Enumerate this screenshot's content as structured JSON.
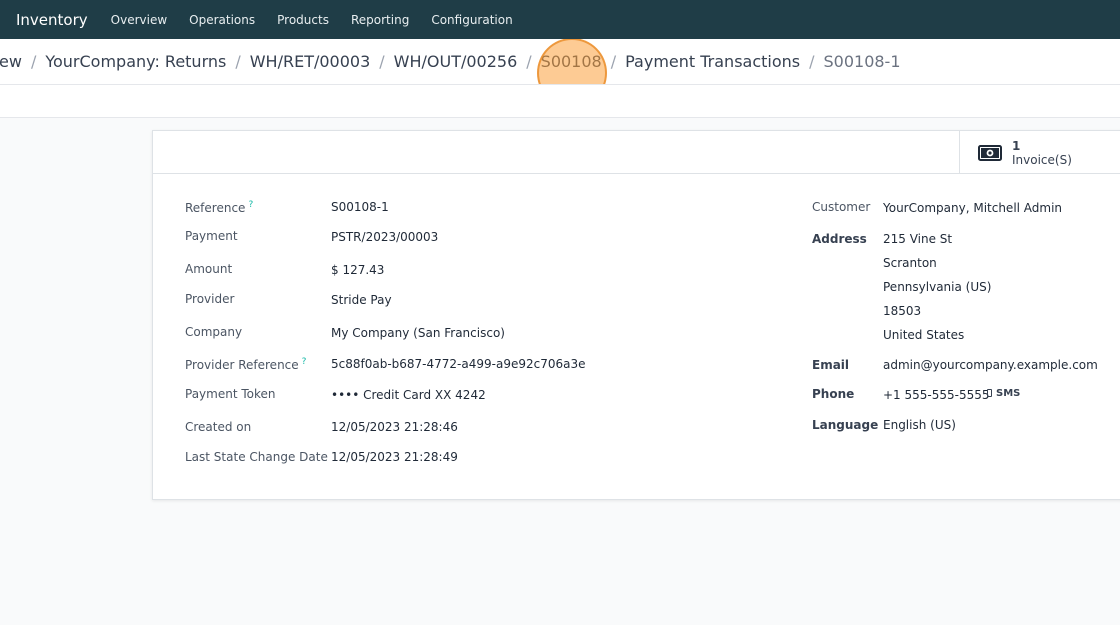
{
  "navbar": {
    "app_name": "Inventory",
    "menu": [
      "Overview",
      "Operations",
      "Products",
      "Reporting",
      "Configuration"
    ]
  },
  "breadcrumb": {
    "items": [
      "ew",
      "YourCompany: Returns",
      "WH/RET/00003",
      "WH/OUT/00256",
      "S00108",
      "Payment Transactions"
    ],
    "separator": "/",
    "current": "S00108-1"
  },
  "stat_button": {
    "value": "1",
    "label": "Invoice(S)"
  },
  "left_fields": {
    "reference": {
      "label": "Reference",
      "help": "?",
      "value": "S00108-1"
    },
    "payment": {
      "label": "Payment",
      "value": "PSTR/2023/00003"
    },
    "amount": {
      "label": "Amount",
      "value": "$ 127.43"
    },
    "provider": {
      "label": "Provider",
      "value": "Stride Pay"
    },
    "company": {
      "label": "Company",
      "value": "My Company (San Francisco)"
    },
    "provider_reference": {
      "label": "Provider Reference",
      "help": "?",
      "value": "5c88f0ab-b687-4772-a499-a9e92c706a3e"
    },
    "payment_token": {
      "label": "Payment Token",
      "value": "•••• Credit Card XX 4242"
    },
    "created_on": {
      "label": "Created on",
      "value": "12/05/2023 21:28:46"
    },
    "last_state_change": {
      "label": "Last State Change Date",
      "value": "12/05/2023 21:28:49"
    }
  },
  "right_fields": {
    "customer": {
      "label": "Customer",
      "value": "YourCompany, Mitchell Admin"
    },
    "address": {
      "label": "Address",
      "lines": [
        "215 Vine St",
        "Scranton",
        "Pennsylvania (US)",
        "18503",
        "United States"
      ]
    },
    "email": {
      "label": "Email",
      "value": "admin@yourcompany.example.com"
    },
    "phone": {
      "label": "Phone",
      "value": "+1 555-555-5555",
      "sms": "SMS"
    },
    "language": {
      "label": "Language",
      "value": "English (US)"
    }
  },
  "colors": {
    "navbar": "#1f3d47",
    "highlight": "#fba03c"
  }
}
